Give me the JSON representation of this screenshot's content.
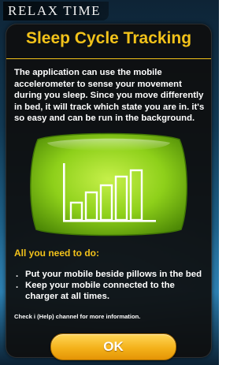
{
  "app": {
    "title": "RELAX TIME"
  },
  "dialog": {
    "title": "Sleep Cycle Tracking",
    "description": "The application  can use the mobile accelerometer to sense your movement during you sleep. Since you move differently in bed, it will track which state you are in.  it's so easy and can be run in the background.",
    "illustration_icon": "pillow-bar-chart-icon",
    "requirements_title": "All you need to do:",
    "requirements": [
      "Put your mobile beside pillows in the bed",
      "Keep your mobile connected to the charger at all times."
    ],
    "help_note": "Check i (Help) channel for more information.",
    "ok_label": "OK"
  },
  "colors": {
    "accent": "#f2c21a",
    "dialog_background": "#0e0e0e",
    "pillow_green": "#8ed01a",
    "button_orange": "#f4b21a"
  }
}
